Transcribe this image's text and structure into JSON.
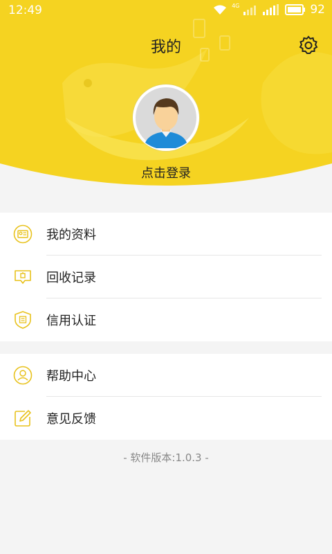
{
  "status": {
    "time": "12:49",
    "battery": "92",
    "network": "4G"
  },
  "header": {
    "title": "我的"
  },
  "profile": {
    "login_label": "点击登录"
  },
  "menu_group_1": [
    {
      "label": "我的资料",
      "icon": "profile-card-icon"
    },
    {
      "label": "回收记录",
      "icon": "recycle-record-icon"
    },
    {
      "label": "信用认证",
      "icon": "credit-shield-icon"
    }
  ],
  "menu_group_2": [
    {
      "label": "帮助中心",
      "icon": "help-person-icon"
    },
    {
      "label": "意见反馈",
      "icon": "feedback-edit-icon"
    }
  ],
  "footer": {
    "version": "- 软件版本:1.0.3 -"
  },
  "colors": {
    "brand": "#f5d321",
    "accent_icon": "#e8c21c",
    "bg": "#f4f4f4"
  }
}
